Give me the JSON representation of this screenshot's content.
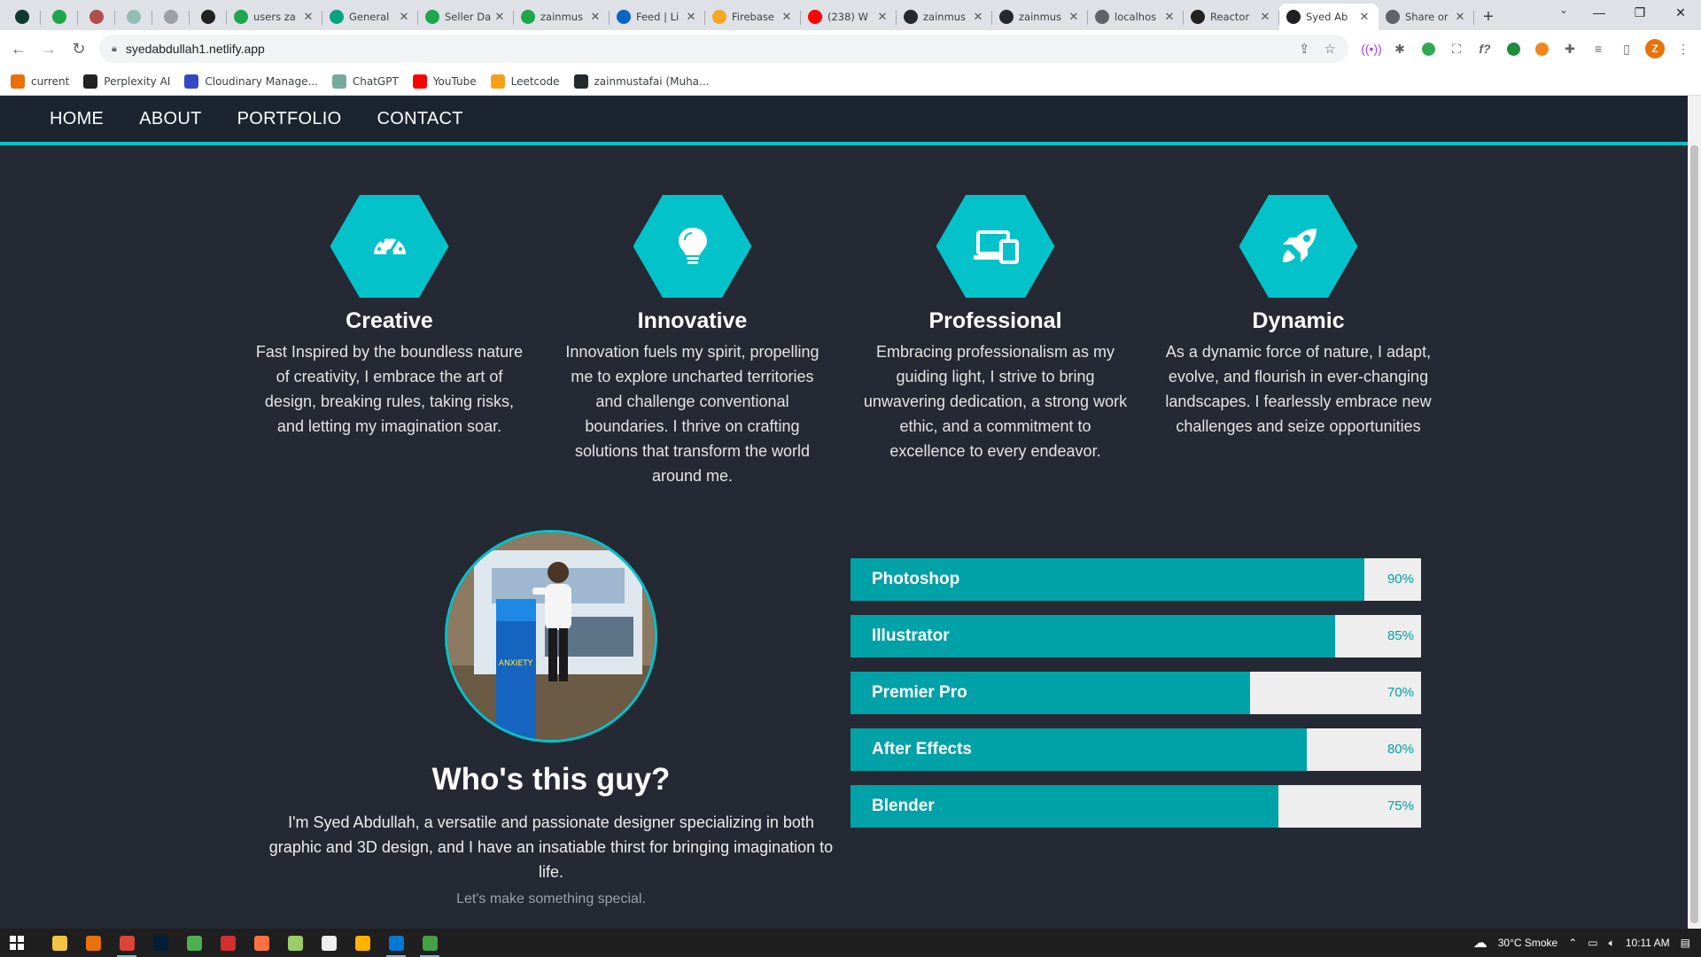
{
  "browser": {
    "tabs": [
      {
        "label": "",
        "pinned": true,
        "icon": "app-icon",
        "color": "#0e3b2f"
      },
      {
        "label": "",
        "pinned": true,
        "icon": "app-icon",
        "color": "#1ea64b"
      },
      {
        "label": "",
        "pinned": true,
        "icon": "react-icon",
        "color": "#b04d4d"
      },
      {
        "label": "",
        "pinned": true,
        "icon": "chatgpt-icon",
        "color": "#8fbfb1"
      },
      {
        "label": "",
        "pinned": true,
        "icon": "triangle-icon",
        "color": "#9aa0a6"
      },
      {
        "label": "",
        "pinned": true,
        "icon": "app-icon",
        "color": "#222222"
      },
      {
        "label": "users za",
        "icon": "app-icon",
        "color": "#1ea64b"
      },
      {
        "label": "General",
        "icon": "diamond-icon",
        "color": "#0aa380"
      },
      {
        "label": "Seller Da",
        "icon": "app-icon",
        "color": "#1ea64b"
      },
      {
        "label": "zainmus",
        "icon": "app-icon",
        "color": "#1ea64b"
      },
      {
        "label": "Feed | Li",
        "icon": "linkedin-icon",
        "color": "#0a66c2"
      },
      {
        "label": "Firebase",
        "icon": "firebase-icon",
        "color": "#f5a623"
      },
      {
        "label": "(238) W",
        "icon": "youtube-icon",
        "color": "#ff0000"
      },
      {
        "label": "zainmus",
        "icon": "github-icon",
        "color": "#24292f"
      },
      {
        "label": "zainmus",
        "icon": "github-icon",
        "color": "#24292f"
      },
      {
        "label": "localhos",
        "icon": "globe-icon",
        "color": "#5f6368"
      },
      {
        "label": "Reactor",
        "icon": "app-icon",
        "color": "#222222"
      },
      {
        "label": "Syed Ab",
        "icon": "app-icon",
        "color": "#202124",
        "active": true
      },
      {
        "label": "Share or",
        "icon": "globe-icon",
        "color": "#5f6368"
      }
    ],
    "url": "syedabdullah1.netlify.app",
    "bookmarks": [
      {
        "label": "current",
        "color": "#e8710a"
      },
      {
        "label": "Perplexity AI",
        "color": "#222222"
      },
      {
        "label": "Cloudinary Manage...",
        "color": "#3448c5"
      },
      {
        "label": "ChatGPT",
        "color": "#74aa9c"
      },
      {
        "label": "YouTube",
        "color": "#ff0000"
      },
      {
        "label": "Leetcode",
        "color": "#f89f1b"
      },
      {
        "label": "zainmustafai (Muha...",
        "color": "#24292f"
      }
    ],
    "profile_initial": "Z"
  },
  "nav": {
    "items": [
      "HOME",
      "ABOUT",
      "PORTFOLIO",
      "CONTACT"
    ]
  },
  "features": [
    {
      "icon": "speedometer-icon",
      "title": "Creative",
      "text": "Fast Inspired by the boundless nature of creativity, I embrace the art of design, breaking rules, taking risks, and letting my imagination soar."
    },
    {
      "icon": "lightbulb-icon",
      "title": "Innovative",
      "text": "Innovation fuels my spirit, propelling me to explore uncharted territories and challenge conventional boundaries. I thrive on crafting solutions that transform the world around me."
    },
    {
      "icon": "devices-icon",
      "title": "Professional",
      "text": "Embracing professionalism as my guiding light, I strive to bring unwavering dedication, a strong work ethic, and a commitment to excellence to every endeavor."
    },
    {
      "icon": "rocket-icon",
      "title": "Dynamic",
      "text": "As a dynamic force of nature, I adapt, evolve, and flourish in ever-changing landscapes. I fearlessly embrace new challenges and seize opportunities"
    }
  ],
  "about": {
    "title": "Who's this guy?",
    "text": "I'm Syed Abdullah, a versatile and passionate designer specializing in both graphic and 3D design, and I have an insatiable thirst for bringing imagination to life.",
    "cta": "Let's make something special.",
    "stand_text": "ANXIETY"
  },
  "skills": [
    {
      "name": "Photoshop",
      "percent": 90,
      "label": "90%"
    },
    {
      "name": "Illustrator",
      "percent": 85,
      "label": "85%"
    },
    {
      "name": "Premier Pro",
      "percent": 70,
      "label": "70%"
    },
    {
      "name": "After Effects",
      "percent": 80,
      "label": "80%"
    },
    {
      "name": "Blender",
      "percent": 75,
      "label": "75%"
    }
  ],
  "taskbar": {
    "weather": "30°C  Smoke",
    "time": "10:11 AM",
    "apps": [
      {
        "icon": "file-explorer-icon",
        "color": "#f4c542"
      },
      {
        "icon": "app-icon",
        "color": "#e8710a"
      },
      {
        "icon": "chrome-icon",
        "color": "#db4437",
        "running": true
      },
      {
        "icon": "photoshop-icon",
        "color": "#001e36"
      },
      {
        "icon": "app-icon",
        "color": "#4caf50"
      },
      {
        "icon": "wps-icon",
        "color": "#d32f2f"
      },
      {
        "icon": "app-icon",
        "color": "#ff7043"
      },
      {
        "icon": "notepad-icon",
        "color": "#9ccc65"
      },
      {
        "icon": "app-icon",
        "color": "#eeeeee"
      },
      {
        "icon": "app-icon",
        "color": "#ffb300"
      },
      {
        "icon": "vscode-icon",
        "color": "#0078d4",
        "running": true
      },
      {
        "icon": "app-icon",
        "color": "#43a047",
        "running": true
      }
    ]
  },
  "colors": {
    "accent": "#04c2c9",
    "bar_fill": "#00a1a7",
    "nav_bg": "#1b242f",
    "page_bg": "#252934"
  }
}
